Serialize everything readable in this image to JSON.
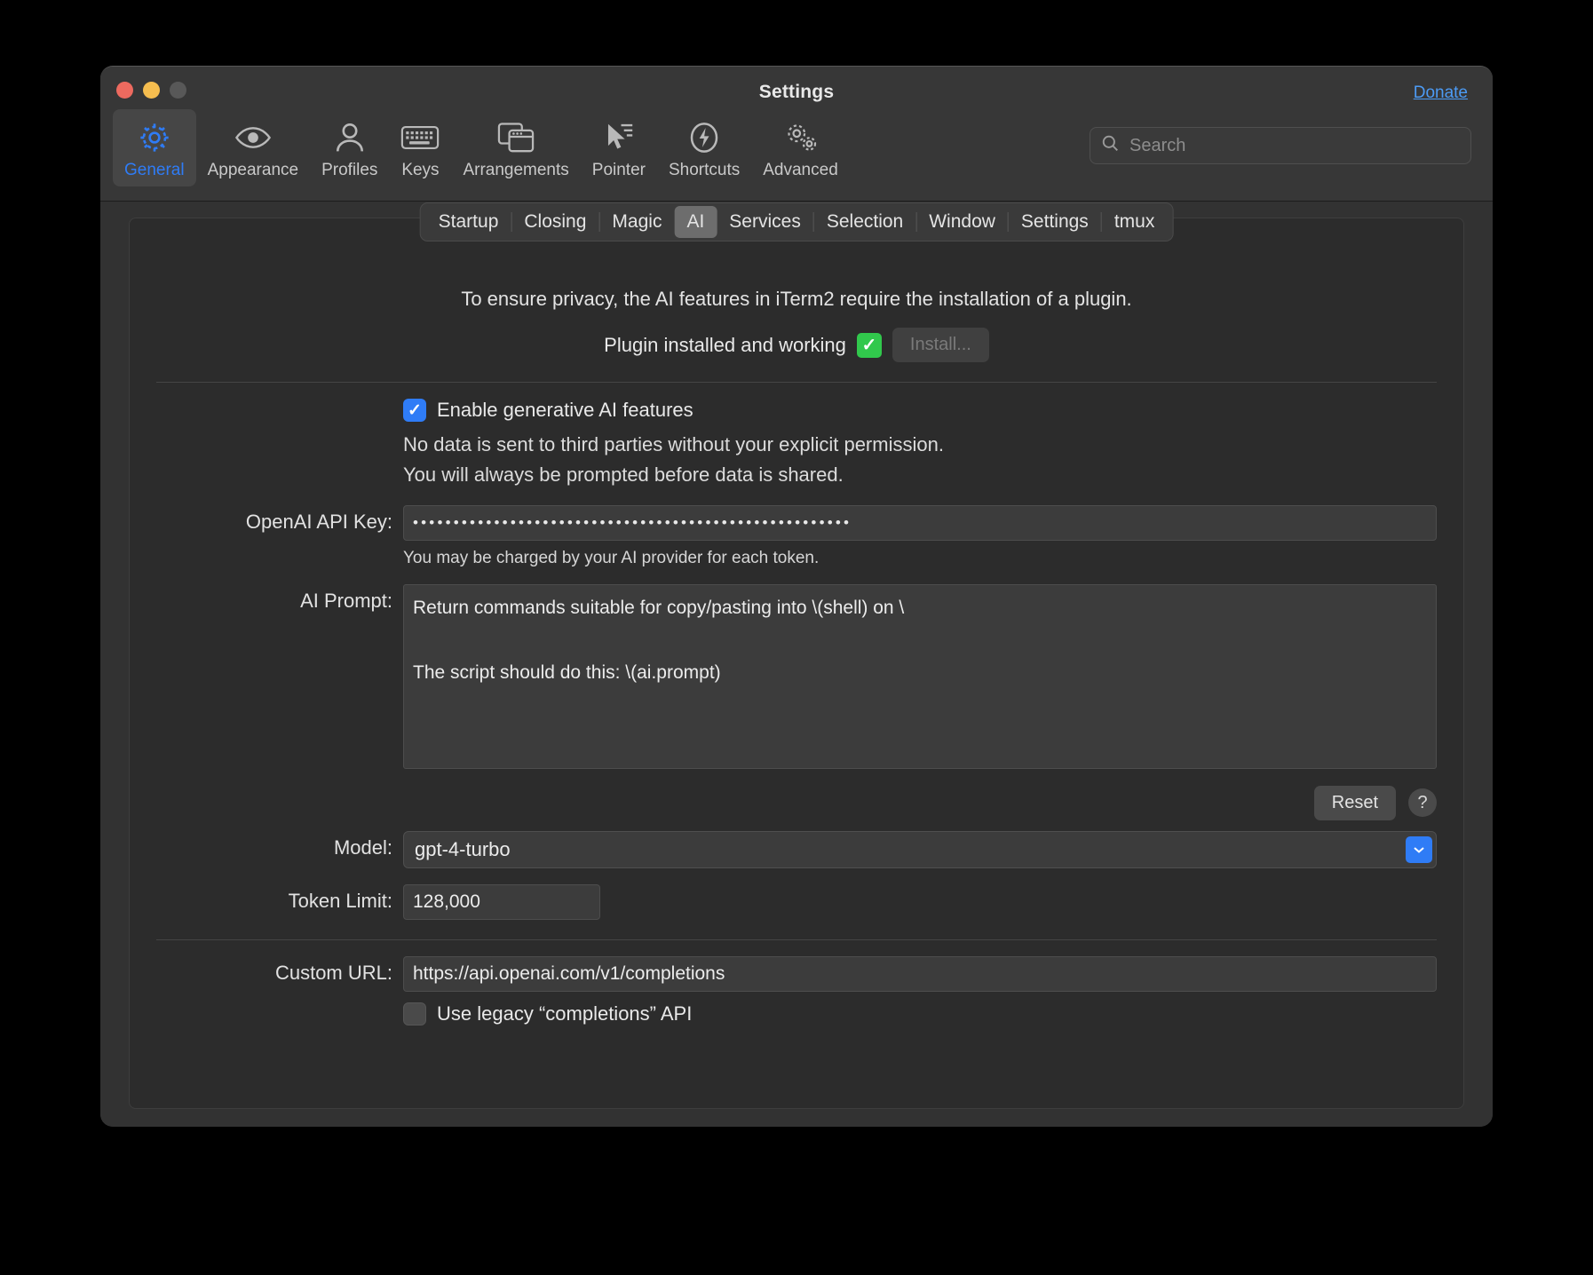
{
  "window": {
    "title": "Settings",
    "donate_label": "Donate",
    "traffic_lights": [
      "close-button",
      "minimize-button",
      "zoom-button"
    ]
  },
  "toolbar": {
    "items": [
      {
        "label": "General",
        "icon": "gear-icon",
        "selected": true
      },
      {
        "label": "Appearance",
        "icon": "eye-icon",
        "selected": false
      },
      {
        "label": "Profiles",
        "icon": "person-icon",
        "selected": false
      },
      {
        "label": "Keys",
        "icon": "keyboard-icon",
        "selected": false
      },
      {
        "label": "Arrangements",
        "icon": "windows-icon",
        "selected": false
      },
      {
        "label": "Pointer",
        "icon": "cursor-icon",
        "selected": false
      },
      {
        "label": "Shortcuts",
        "icon": "bolt-circle-icon",
        "selected": false
      },
      {
        "label": "Advanced",
        "icon": "gears-icon",
        "selected": false
      }
    ]
  },
  "search": {
    "placeholder": "Search",
    "value": "",
    "icon": "search-icon"
  },
  "tabs": {
    "items": [
      "Startup",
      "Closing",
      "Magic",
      "AI",
      "Services",
      "Selection",
      "Window",
      "Settings",
      "tmux"
    ],
    "active": "AI"
  },
  "ai": {
    "privacy_notice": "To ensure privacy, the AI features in iTerm2 require the installation of a plugin.",
    "plugin_status": "Plugin installed and working",
    "plugin_status_icon": "green-check-icon",
    "install_button": "Install...",
    "install_button_disabled": true,
    "enable_checkbox": {
      "label": "Enable generative AI features",
      "checked": true
    },
    "enable_help_line1": "No data is sent to third parties without your explicit permission.",
    "enable_help_line2": "You will always be prompted before data is shared.",
    "api_key": {
      "label": "OpenAI API Key:",
      "value": "••••••••••••••••••••••••••••••••••••••••••••••••••••••",
      "note": "You may be charged by your AI provider for each token."
    },
    "prompt": {
      "label": "AI Prompt:",
      "value": "Return commands suitable for copy/pasting into \\(shell) on \\\n\nThe script should do this: \\(ai.prompt)"
    },
    "reset_button": "Reset",
    "help_button": "?",
    "model": {
      "label": "Model:",
      "value": "gpt-4-turbo",
      "options": [
        "gpt-4-turbo"
      ],
      "arrow_icon": "chevron-down-icon"
    },
    "token_limit": {
      "label": "Token Limit:",
      "value": "128,000"
    },
    "custom_url": {
      "label": "Custom URL:",
      "value": "https://api.openai.com/v1/completions"
    },
    "legacy_checkbox": {
      "label": "Use legacy “completions” API",
      "checked": false
    }
  },
  "colors": {
    "accent_blue": "#2f7cf6",
    "link_blue": "#4c9bf5",
    "status_green": "#31c84c",
    "window_bg": "#323232",
    "panel_bg": "#2c2c2c"
  }
}
